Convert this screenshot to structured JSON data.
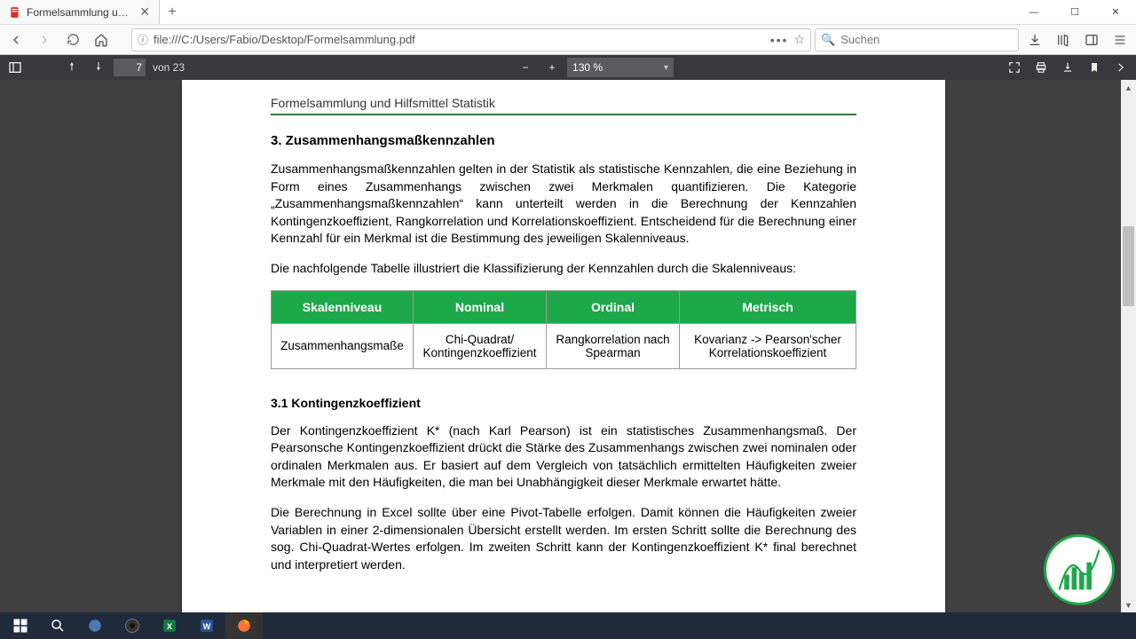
{
  "window": {
    "tab_title": "Formelsammlung und Hilfsmittel S",
    "minimize": "—",
    "maximize": "☐",
    "close": "✕"
  },
  "toolbar": {
    "url": "file:///C:/Users/Fabio/Desktop/Formelsammlung.pdf",
    "search_placeholder": "Suchen"
  },
  "pdf": {
    "page_current": "7",
    "page_of": "von 23",
    "zoom": "130 %"
  },
  "doc": {
    "running_head": "Formelsammlung und Hilfsmittel Statistik",
    "h3": "3. Zusammenhangsmaßkennzahlen",
    "p1": "Zusammenhangsmaßkennzahlen gelten in der Statistik als statistische Kennzahlen, die eine Beziehung in Form eines Zusammenhangs zwischen zwei Merkmalen quantifizieren. Die Kategorie „Zusammenhangsmaßkennzahlen“ kann unterteilt werden in die Berechnung der Kennzahlen Kontingenzkoeffizient, Rangkorrelation und Korrelationskoeffizient. Entscheidend für die Berechnung einer Kennzahl für ein Merkmal ist die Bestimmung des jeweiligen Skalenniveaus.",
    "p2": "Die nachfolgende Tabelle illustriert die Klassifizierung der Kennzahlen durch die Skalenniveaus:",
    "table": {
      "headers": [
        "Skalenniveau",
        "Nominal",
        "Ordinal",
        "Metrisch"
      ],
      "row_label": "Zusammenhangsmaße",
      "cells": [
        "Chi-Quadrat/ Kontingenzkoeffizient",
        "Rangkorrelation nach Spearman",
        "Kovarianz -> Pearson'scher Korrelationskoeffizient"
      ]
    },
    "h31": "3.1 Kontingenzkoeffizient",
    "p3": "Der Kontingenzkoeffizient K* (nach Karl Pearson) ist ein statistisches Zusammenhangsmaß. Der Pearsonsche Kontingenzkoeffizient drückt die Stärke des Zusammenhangs zwischen zwei  nominalen oder ordinalen Merkmalen aus. Er basiert auf dem Vergleich von tatsächlich ermittelten Häufigkeiten zweier Merkmale mit den Häufigkeiten, die man bei Unabhängigkeit dieser Merkmale erwartet hätte.",
    "p4": "Die Berechnung in Excel sollte über eine Pivot-Tabelle erfolgen. Damit können die Häufigkeiten zweier Variablen in einer 2-dimensionalen Übersicht erstellt werden. Im ersten Schritt sollte die Berechnung des sog. Chi-Quadrat-Wertes erfolgen. Im zweiten Schritt kann der Kontingenzkoeffizient K* final berechnet und interpretiert werden."
  }
}
